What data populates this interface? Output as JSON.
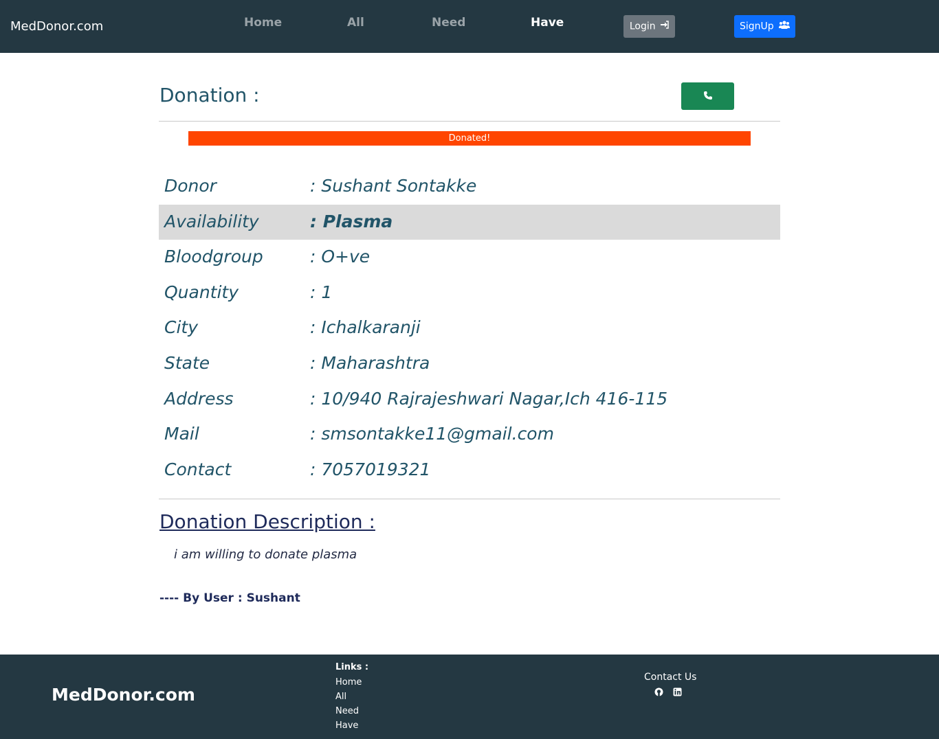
{
  "navbar": {
    "brand": "MedDonor.com",
    "links": [
      "Home",
      "All",
      "Need",
      "Have"
    ],
    "active": "Have",
    "login_label": "Login",
    "signup_label": "SignUp"
  },
  "main": {
    "title": "Donation :",
    "status": "Donated!",
    "status_color": "#ff4500",
    "details": [
      {
        "label": "Donor",
        "value": ": Sushant Sontakke"
      },
      {
        "label": "Availability",
        "value": ": Plasma"
      },
      {
        "label": "Bloodgroup",
        "value": ": O+ve"
      },
      {
        "label": "Quantity",
        "value": ": 1"
      },
      {
        "label": "City",
        "value": ": Ichalkaranji"
      },
      {
        "label": "State",
        "value": ": Maharashtra"
      },
      {
        "label": "Address",
        "value": ": 10/940 Rajrajeshwari Nagar,Ich 416-115"
      },
      {
        "label": "Mail",
        "value": ": smsontakke11@gmail.com"
      },
      {
        "label": "Contact",
        "value": ": 7057019321"
      }
    ],
    "description_title": "Donation Description :",
    "description": "i am willing to donate plasma",
    "by_user": "---- By User : Sushant"
  },
  "footer": {
    "brand": "MedDonor.com",
    "links_title": "Links :",
    "links": [
      "Home",
      "All",
      "Need",
      "Have"
    ],
    "contact_title": "Contact Us",
    "icons": [
      "github-icon",
      "linkedin-icon"
    ]
  },
  "colors": {
    "navbar_bg": "#243842",
    "text_primary": "#215468",
    "call_button": "#198754",
    "signup_button": "#0d6efd",
    "login_button": "#6c757d"
  }
}
